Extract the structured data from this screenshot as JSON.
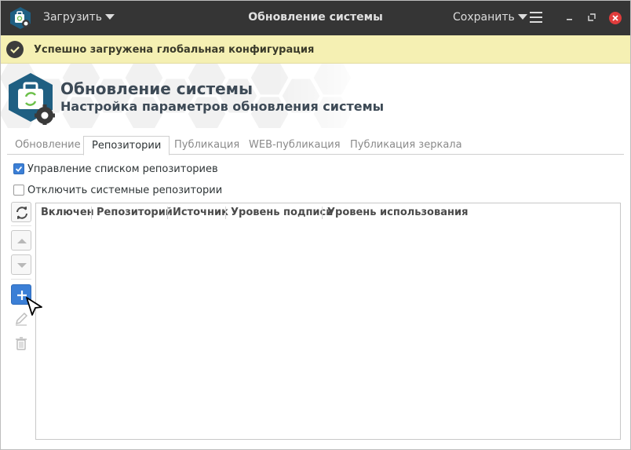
{
  "window": {
    "title": "Обновление системы",
    "load_menu": "Загрузить",
    "save_menu": "Сохранить"
  },
  "notification": {
    "text": "Успешно загружена глобальная конфигурация",
    "icon": "check-icon"
  },
  "header": {
    "title": "Обновление системы",
    "subtitle": "Настройка параметров обновления системы"
  },
  "tabs": [
    {
      "label": "Обновление",
      "active": false
    },
    {
      "label": "Репозитории",
      "active": true
    },
    {
      "label": "Публикация",
      "active": false
    },
    {
      "label": "WEB-публикация",
      "active": false
    },
    {
      "label": "Публикация зеркала",
      "active": false
    }
  ],
  "options": {
    "manage_repos": {
      "label": "Управление списком репозиториев",
      "checked": true
    },
    "disable_system_repos": {
      "label": "Отключить системные репозитории",
      "checked": false
    }
  },
  "toolbar": {
    "icons": [
      "refresh-icon",
      "arrow-up-icon",
      "arrow-down-icon",
      "plus-icon",
      "pencil-icon",
      "trash-icon"
    ]
  },
  "table": {
    "columns": [
      "Включен",
      "Репозиторий",
      "Источник",
      "Уровень подписи",
      "Уровень использования"
    ],
    "rows": []
  },
  "colors": {
    "titlebar": "#353535",
    "notification_bg": "#f5f0b3",
    "accent": "#3b7fd6",
    "close": "#e03c3c"
  }
}
